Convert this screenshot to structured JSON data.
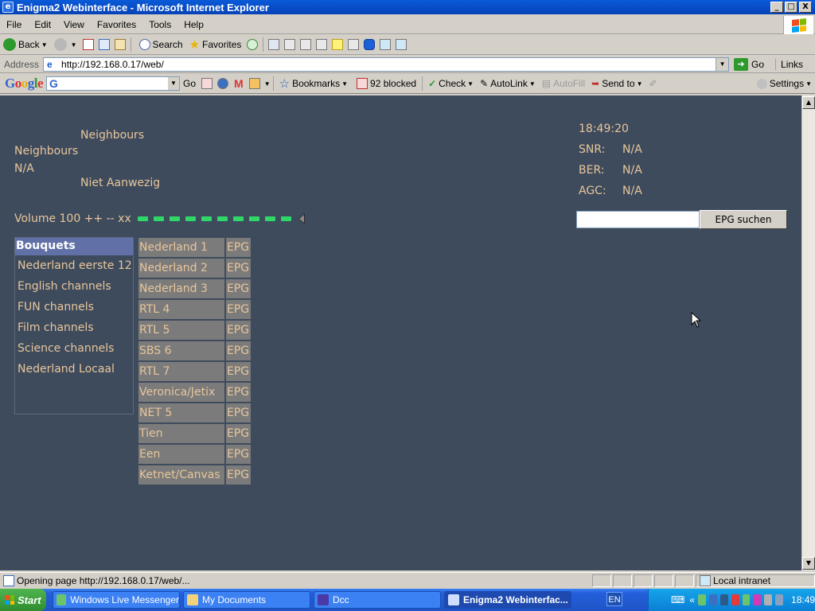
{
  "window": {
    "title": "Enigma2 Webinterface - Microsoft Internet Explorer",
    "buttons": [
      "_",
      "□",
      "X"
    ]
  },
  "menu": [
    "File",
    "Edit",
    "View",
    "Favorites",
    "Tools",
    "Help"
  ],
  "toolbar": {
    "back": "Back",
    "search": "Search",
    "favorites": "Favorites"
  },
  "address": {
    "label": "Address",
    "url": "http://192.168.0.17/web/",
    "go": "Go",
    "links": "Links"
  },
  "google_toolbar": {
    "logo": "Google",
    "go": "Go",
    "bookmarks": "Bookmarks",
    "blocked": "92 blocked",
    "check": "Check",
    "autolink": "AutoLink",
    "autofill": "AutoFill",
    "send_to": "Send to",
    "settings": "Settings"
  },
  "page": {
    "service_name_top": "Neighbours",
    "service_name": "Neighbours",
    "na": "N/A",
    "status": "Niet Aanwezig",
    "clock": "18:49:20",
    "signal": [
      {
        "label": "SNR:",
        "value": "N/A"
      },
      {
        "label": "BER:",
        "value": "N/A"
      },
      {
        "label": "AGC:",
        "value": "N/A"
      }
    ],
    "volume_text": "Volume 100 ++ -- xx",
    "volume_level": 1.0,
    "volume_segments": 10,
    "epg_search_button": "EPG suchen",
    "epg_search_value": "",
    "bouquets_header": "Bouquets",
    "bouquets": [
      "Nederland eerste 12",
      "English channels",
      "FUN channels",
      "Film channels",
      "Science channels",
      "Nederland Locaal"
    ],
    "channels": [
      {
        "name": "Nederland 1",
        "epg": "EPG"
      },
      {
        "name": "Nederland 2",
        "epg": "EPG"
      },
      {
        "name": "Nederland 3",
        "epg": "EPG"
      },
      {
        "name": "RTL 4",
        "epg": "EPG"
      },
      {
        "name": "RTL 5",
        "epg": "EPG"
      },
      {
        "name": "SBS 6",
        "epg": "EPG"
      },
      {
        "name": "RTL 7",
        "epg": "EPG"
      },
      {
        "name": "Veronica/Jetix",
        "epg": "EPG"
      },
      {
        "name": "NET 5",
        "epg": "EPG"
      },
      {
        "name": "Tien",
        "epg": "EPG"
      },
      {
        "name": "Een",
        "epg": "EPG"
      },
      {
        "name": "Ketnet/Canvas",
        "epg": "EPG"
      }
    ]
  },
  "status_bar": {
    "message": "Opening page http://192.168.0.17/web/...",
    "zone": "Local intranet"
  },
  "taskbar": {
    "start": "Start",
    "tasks": [
      {
        "label": "Windows Live Messenger",
        "active": false
      },
      {
        "label": "My Documents",
        "active": false
      },
      {
        "label": "Dcc",
        "active": false
      },
      {
        "label": "Enigma2 Webinterfac...",
        "active": true
      }
    ],
    "language": "EN",
    "clock": "18:49"
  },
  "colors": {
    "page_background": "#3e4b5c",
    "text": "#e8c69c",
    "channel_cell": "#7b7b7b",
    "bouquet_header": "#6171a8",
    "volume_bar": "#2fd66a"
  }
}
